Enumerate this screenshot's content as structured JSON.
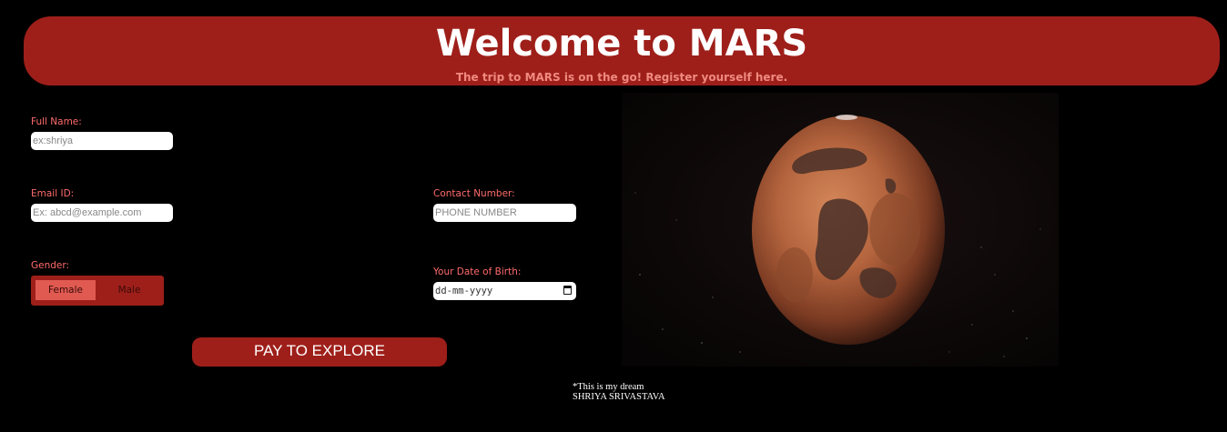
{
  "header": {
    "title": "Welcome to MARS",
    "subtitle": "The trip to MARS is on the go! Register yourself here."
  },
  "form": {
    "full_name": {
      "label": "Full Name:",
      "placeholder": "ex:shriya",
      "value": ""
    },
    "email": {
      "label": "Email ID:",
      "placeholder": "Ex: abcd@example.com",
      "value": ""
    },
    "contact": {
      "label": "Contact Number:",
      "placeholder": "PHONE NUMBER",
      "value": ""
    },
    "gender": {
      "label": "Gender:",
      "options": [
        "Female",
        "Male"
      ],
      "selected": "Female"
    },
    "dob": {
      "label": "Your Date of Birth:",
      "placeholder": "dd-mm-yyyy"
    },
    "submit_label": "PAY TO EXPLORE"
  },
  "image": {
    "subject": "planet-mars",
    "icon": "mars-planet-image"
  },
  "footer": {
    "line1": "*This is my dream",
    "line2": "SHRIYA SRIVASTAVA"
  },
  "colors": {
    "background": "#000000",
    "accent": "#9e1f1a",
    "label": "#ff6b6b",
    "female_selected": "#e05a52"
  }
}
